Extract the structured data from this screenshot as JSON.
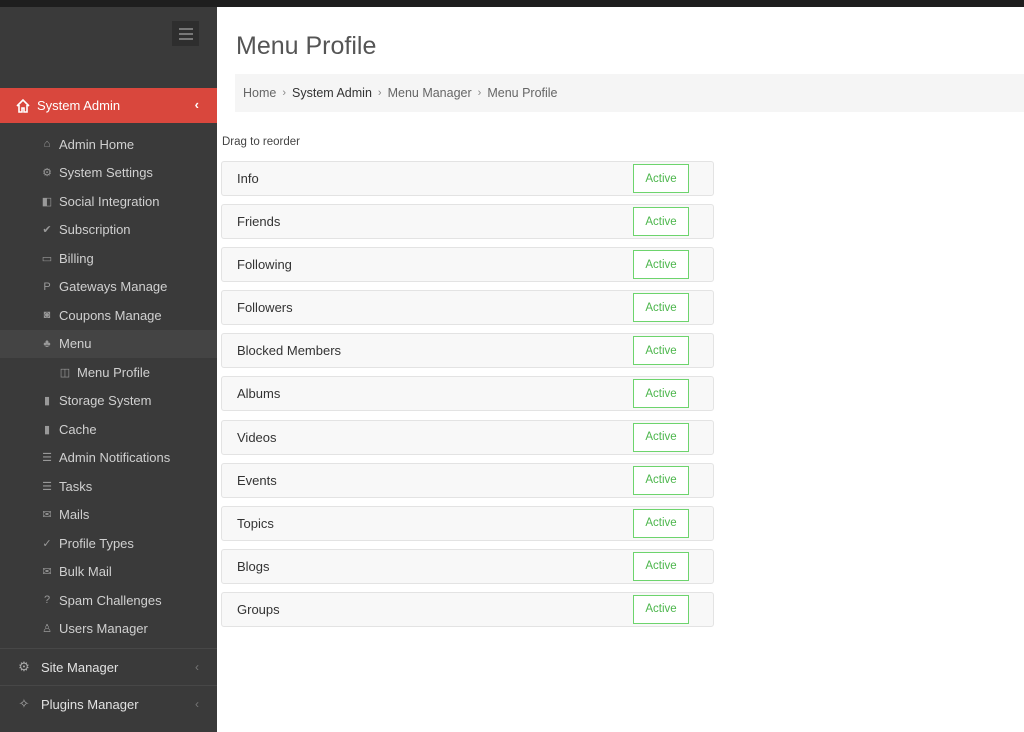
{
  "sidebar": {
    "toggle_icon": "hamburger-icon",
    "section": {
      "label": "System Admin",
      "icon": "home-icon",
      "chevron": "‹"
    },
    "items": [
      {
        "label": "Admin Home",
        "icon": "home-outline-icon",
        "glyph": "⌂"
      },
      {
        "label": "System Settings",
        "icon": "gear-icon",
        "glyph": "⚙"
      },
      {
        "label": "Social Integration",
        "icon": "share-icon",
        "glyph": "◧"
      },
      {
        "label": "Subscription",
        "icon": "check-icon",
        "glyph": "✔"
      },
      {
        "label": "Billing",
        "icon": "credit-card-icon",
        "glyph": "▭"
      },
      {
        "label": "Gateways Manage",
        "icon": "paypal-icon",
        "glyph": "P"
      },
      {
        "label": "Coupons Manage",
        "icon": "money-icon",
        "glyph": "◙"
      },
      {
        "label": "Menu",
        "icon": "sitemap-icon",
        "glyph": "♣",
        "active": true
      },
      {
        "label": "Menu Profile",
        "icon": "columns-icon",
        "glyph": "◫",
        "level": 2
      },
      {
        "label": "Storage System",
        "icon": "file-icon",
        "glyph": "▮"
      },
      {
        "label": "Cache",
        "icon": "file-icon",
        "glyph": "▮"
      },
      {
        "label": "Admin Notifications",
        "icon": "list-icon",
        "glyph": "☰"
      },
      {
        "label": "Tasks",
        "icon": "list-icon",
        "glyph": "☰"
      },
      {
        "label": "Mails",
        "icon": "envelope-icon",
        "glyph": "✉"
      },
      {
        "label": "Profile Types",
        "icon": "check-circle-icon",
        "glyph": "✓"
      },
      {
        "label": "Bulk Mail",
        "icon": "envelope-icon",
        "glyph": "✉"
      },
      {
        "label": "Spam Challenges",
        "icon": "question-circle-icon",
        "glyph": "?"
      },
      {
        "label": "Users Manager",
        "icon": "user-icon",
        "glyph": "♙"
      }
    ],
    "bottom": [
      {
        "label": "Site Manager",
        "icon": "gears-icon",
        "glyph": "⚙",
        "chevron": "‹"
      },
      {
        "label": "Plugins Manager",
        "icon": "puzzle-icon",
        "glyph": "✧",
        "chevron": "‹"
      }
    ]
  },
  "main": {
    "title": "Menu Profile",
    "breadcrumb": [
      "Home",
      "System Admin",
      "Menu Manager",
      "Menu Profile"
    ],
    "breadcrumb_sep": "›",
    "hint": "Drag to reorder",
    "rows": [
      {
        "label": "Info",
        "status": "Active"
      },
      {
        "label": "Friends",
        "status": "Active"
      },
      {
        "label": "Following",
        "status": "Active"
      },
      {
        "label": "Followers",
        "status": "Active"
      },
      {
        "label": "Blocked Members",
        "status": "Active"
      },
      {
        "label": "Albums",
        "status": "Active"
      },
      {
        "label": "Videos",
        "status": "Active"
      },
      {
        "label": "Events",
        "status": "Active"
      },
      {
        "label": "Topics",
        "status": "Active"
      },
      {
        "label": "Blogs",
        "status": "Active"
      },
      {
        "label": "Groups",
        "status": "Active"
      }
    ]
  },
  "colors": {
    "accent": "#d9473d",
    "sidebar_bg": "#3a3a3a",
    "status_green": "#4cb64c"
  }
}
